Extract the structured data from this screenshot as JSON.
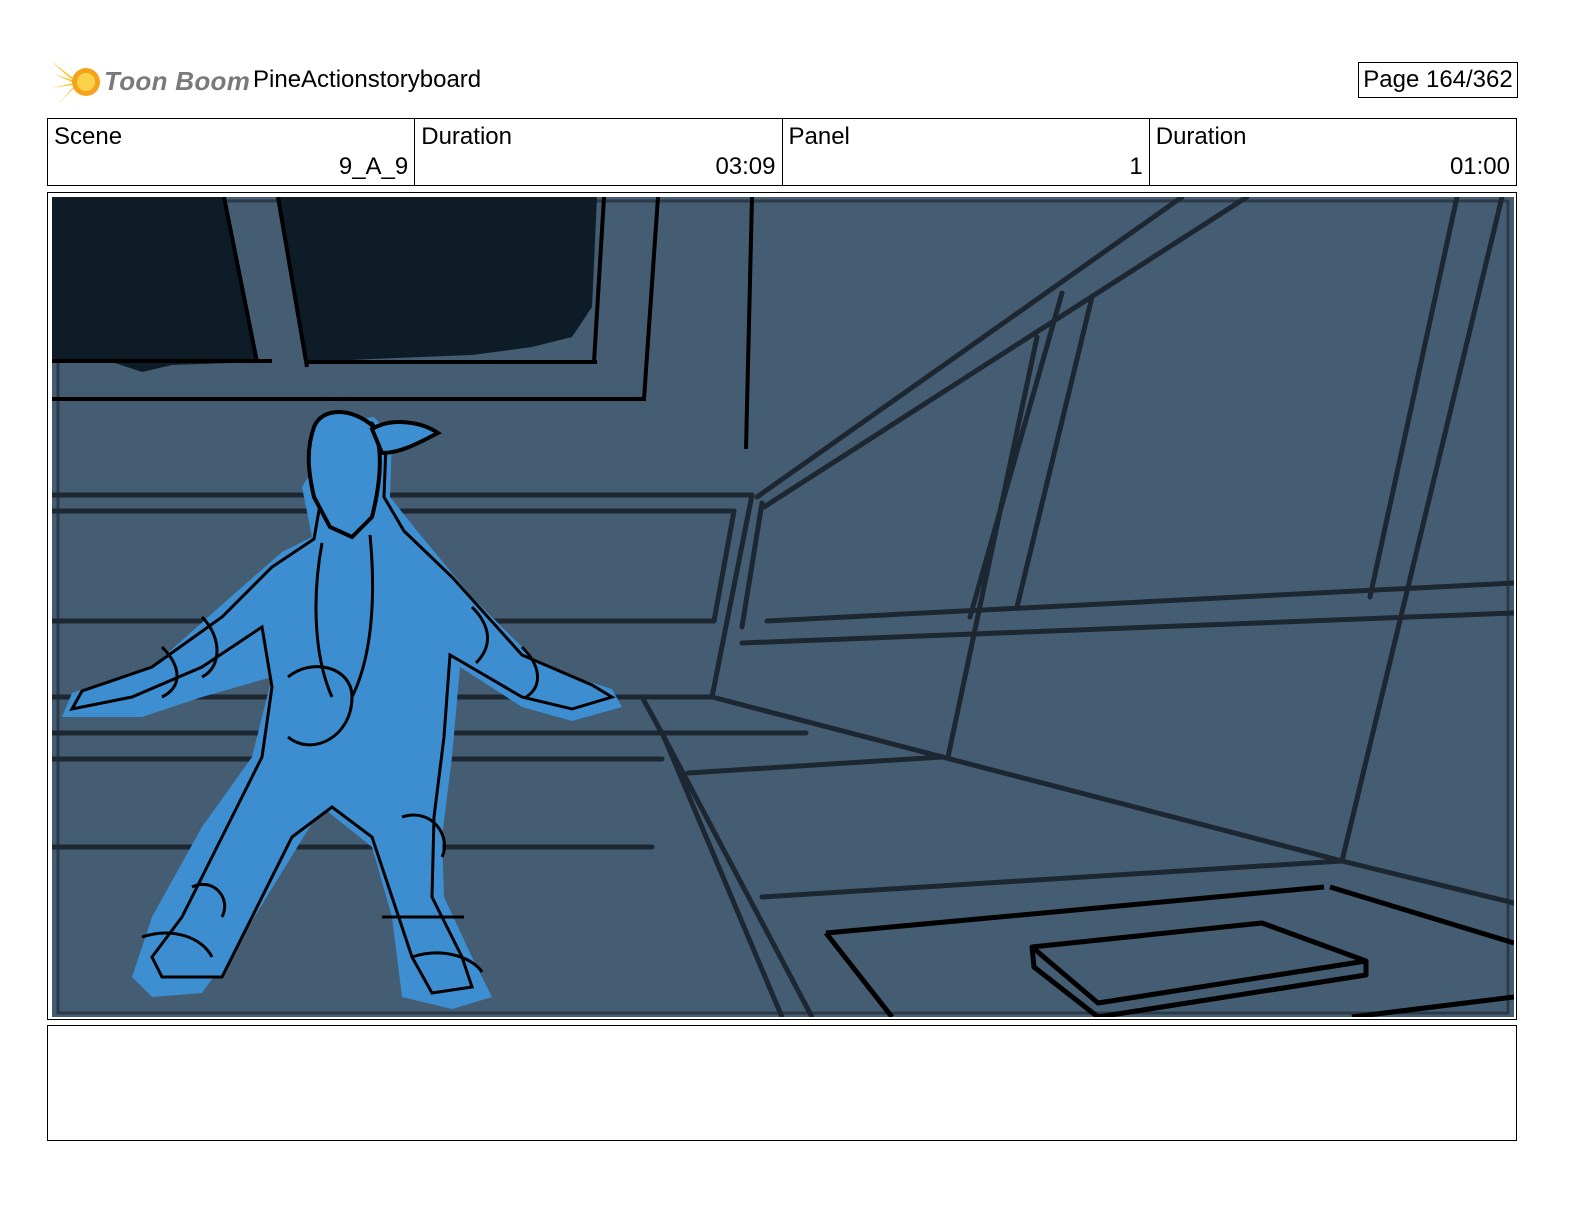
{
  "header": {
    "logo_text": "Toon Boom",
    "project_title": "PineActionstoryboard",
    "page_label": "Page 164/362"
  },
  "info": {
    "scene_label": "Scene",
    "scene_value": "9_A_9",
    "scene_duration_label": "Duration",
    "scene_duration_value": "03:09",
    "panel_label": "Panel",
    "panel_value": "1",
    "panel_duration_label": "Duration",
    "panel_duration_value": "01:00"
  },
  "colors": {
    "background_wall": "#455d73",
    "figure_fill": "#3d8fd1",
    "window_dark": "#0e1c27",
    "line": "#1a1a1a",
    "logo_yellow": "#f5c21b"
  },
  "panel": {
    "description_icon": "storyboard-sketch-character-in-room"
  },
  "notes": {
    "text": ""
  }
}
